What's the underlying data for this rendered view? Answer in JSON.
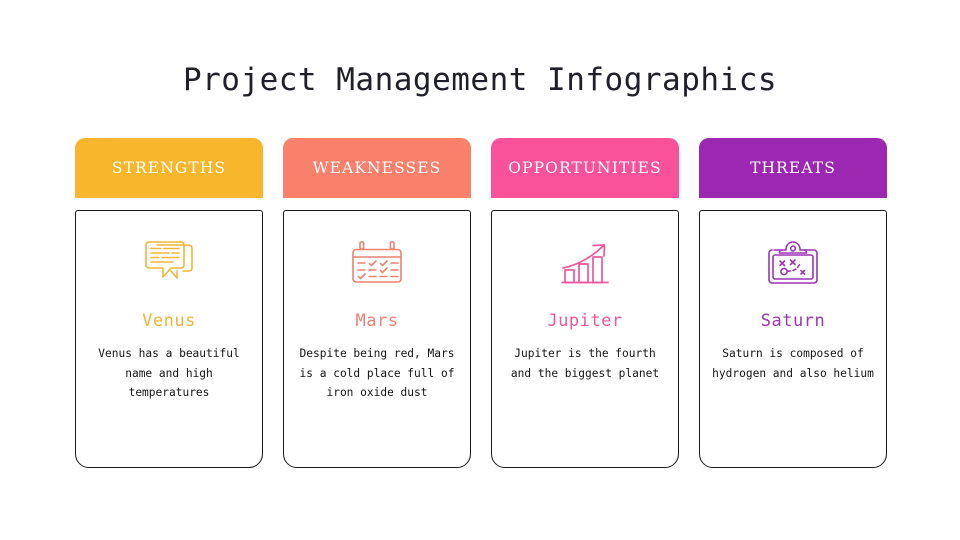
{
  "slide": {
    "title": "Project Management Infographics",
    "background_color": "#ffffff"
  },
  "columns": [
    {
      "header_label": "STRENGTHS",
      "header_color": "#f7b62c",
      "accent_color": "#f7b62c",
      "icon_name": "chat-bubbles-icon",
      "card_title": "Venus",
      "card_text": "Venus has a beautiful name and high temperatures"
    },
    {
      "header_label": "WEAKNESSES",
      "header_color": "#f9806a",
      "accent_color": "#f9806a",
      "icon_name": "calendar-checklist-icon",
      "card_title": "Mars",
      "card_text": "Despite being red, Mars is a cold place full of iron oxide dust"
    },
    {
      "header_label": "OPPORTUNITIES",
      "header_color": "#f9519a",
      "accent_color": "#f9519a",
      "icon_name": "growth-bar-chart-icon",
      "card_title": "Jupiter",
      "card_text": "Jupiter is the fourth and the biggest planet"
    },
    {
      "header_label": "THREATS",
      "header_color": "#9c27b0",
      "accent_color": "#9c27b0",
      "icon_name": "strategy-board-icon",
      "card_title": "Saturn",
      "card_text": "Saturn is composed of hydrogen and also helium"
    }
  ]
}
